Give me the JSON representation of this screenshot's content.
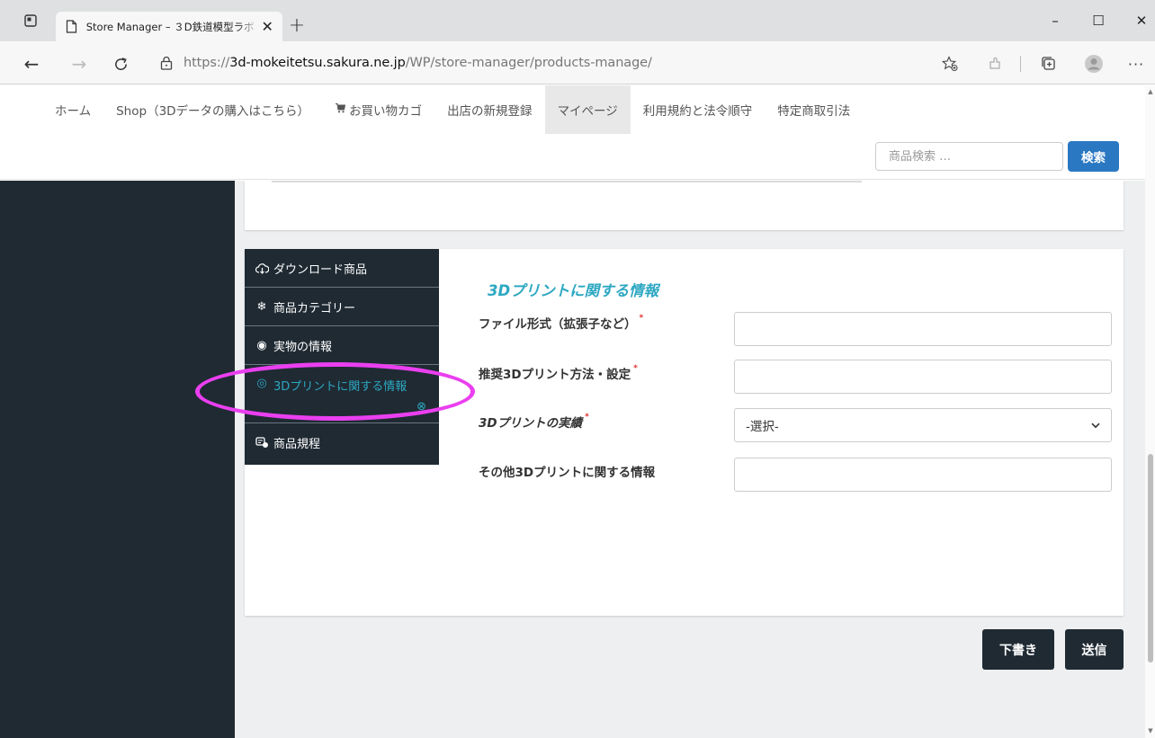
{
  "browser": {
    "tab_title": "Store Manager – ３D鉄道模型ラボ",
    "url_prefix": "https://",
    "url_host": "3d-mokeitetsu.sakura.ne.jp",
    "url_path": "/WP/store-manager/products-manage/",
    "window_controls": {
      "minimize": "–",
      "maximize": "☐",
      "close": "✕"
    },
    "icons": [
      "window-menu-icon",
      "page-icon",
      "close-icon",
      "new-tab-icon",
      "back-icon",
      "forward-icon",
      "refresh-icon",
      "lock-icon",
      "favorite-icon",
      "extensions-icon",
      "collections-icon",
      "profile-icon",
      "more-icon"
    ]
  },
  "nav": {
    "items": [
      {
        "label": "ホーム",
        "active": false
      },
      {
        "label": "Shop（3Dデータの購入はこちら）",
        "active": false
      },
      {
        "label": "お買い物カゴ",
        "active": false,
        "icon": "cart-icon"
      },
      {
        "label": "出店の新規登録",
        "active": false
      },
      {
        "label": "マイページ",
        "active": true
      },
      {
        "label": "利用規約と法令順守",
        "active": false
      },
      {
        "label": "特定商取引法",
        "active": false
      }
    ]
  },
  "search": {
    "placeholder": "商品検索 …",
    "button": "検索"
  },
  "tabs": [
    {
      "label": "ダウンロード商品",
      "icon": "download-cloud-icon",
      "active": false
    },
    {
      "label": "商品カテゴリー",
      "icon": "snowflake-icon",
      "active": false
    },
    {
      "label": "実物の情報",
      "icon": "target-icon",
      "active": false
    },
    {
      "label": "3Dプリントに関する情報",
      "icon": "radio-circle-icon",
      "active": true
    },
    {
      "label": "商品規程",
      "icon": "policy-icon",
      "active": false
    }
  ],
  "form": {
    "section_title": "3Dプリントに関する情報",
    "fields": [
      {
        "label": "ファイル形式（拡張子など）",
        "required": true,
        "type": "text",
        "value": ""
      },
      {
        "label": "推奨3Dプリント方法・設定",
        "required": true,
        "type": "text",
        "value": ""
      },
      {
        "label": "3Dプリントの実績",
        "required": true,
        "type": "select",
        "value": "-選択-"
      },
      {
        "label": "その他3Dプリントに関する情報",
        "required": false,
        "type": "text",
        "value": ""
      }
    ],
    "required_mark": "*"
  },
  "actions": {
    "draft": "下書き",
    "submit": "送信"
  },
  "colors": {
    "accent": "#2ea8c2",
    "dark": "#1f2a33",
    "primary_button": "#2a78c2",
    "annotation": "#ea3ff0",
    "required": "#e03030"
  }
}
